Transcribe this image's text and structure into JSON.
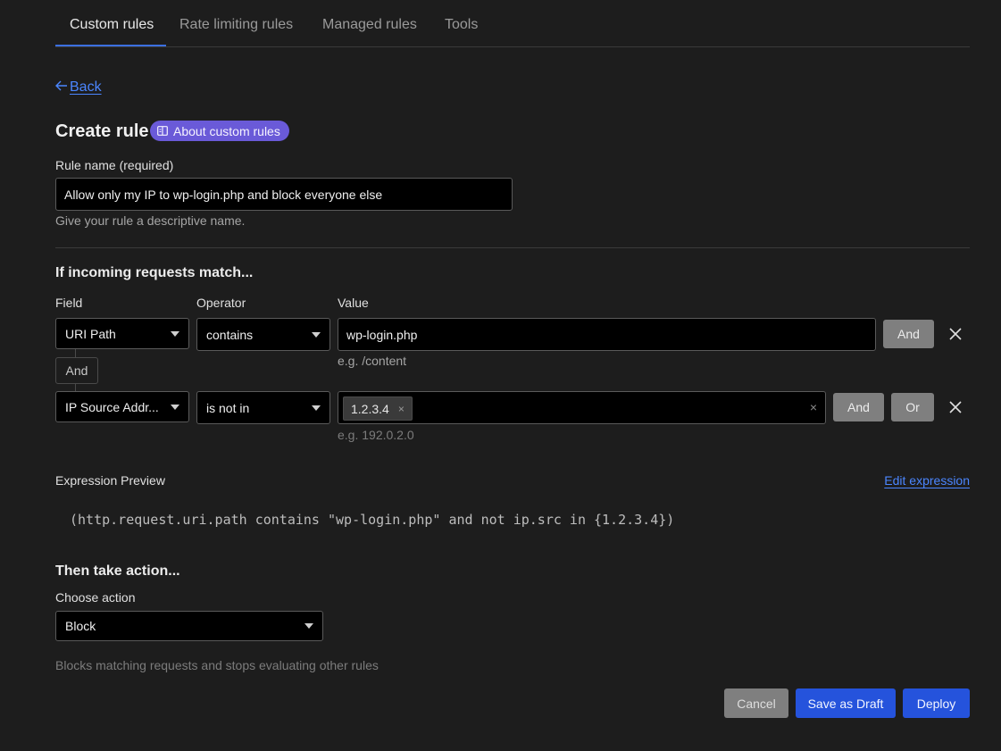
{
  "tabs": [
    {
      "label": "Custom rules",
      "active": true
    },
    {
      "label": "Rate limiting rules",
      "active": false
    },
    {
      "label": "Managed rules",
      "active": false
    },
    {
      "label": "Tools",
      "active": false
    }
  ],
  "back_label": "Back",
  "page_title": "Create rule",
  "about_link": "About custom rules",
  "rule_name": {
    "label": "Rule name (required)",
    "value": "Allow only my IP to wp-login.php and block everyone else",
    "help": "Give your rule a descriptive name."
  },
  "match": {
    "heading": "If incoming requests match...",
    "col_field": "Field",
    "col_operator": "Operator",
    "col_value": "Value",
    "connector": "And",
    "rows": [
      {
        "field": "URI Path",
        "operator": "contains",
        "value": "wp-login.php",
        "help": "e.g. /content",
        "buttons": [
          "And"
        ]
      },
      {
        "field": "IP Source Addr...",
        "operator": "is not in",
        "chip": "1.2.3.4",
        "chip_remove": "×",
        "clear": "×",
        "help": "e.g. 192.0.2.0",
        "buttons": [
          "And",
          "Or"
        ]
      }
    ]
  },
  "expression": {
    "label": "Expression Preview",
    "edit": "Edit expression",
    "text": "(http.request.uri.path contains \"wp-login.php\" and not ip.src in {1.2.3.4})"
  },
  "action": {
    "heading": "Then take action...",
    "label": "Choose action",
    "value": "Block",
    "help": "Blocks matching requests and stops evaluating other rules"
  },
  "footer": {
    "cancel": "Cancel",
    "save_draft": "Save as Draft",
    "deploy": "Deploy"
  },
  "colors": {
    "background": "#1d1d1d",
    "accent_blue": "#2553dc",
    "link": "#4b86ff",
    "pill_purple": "#6a5ad8"
  }
}
